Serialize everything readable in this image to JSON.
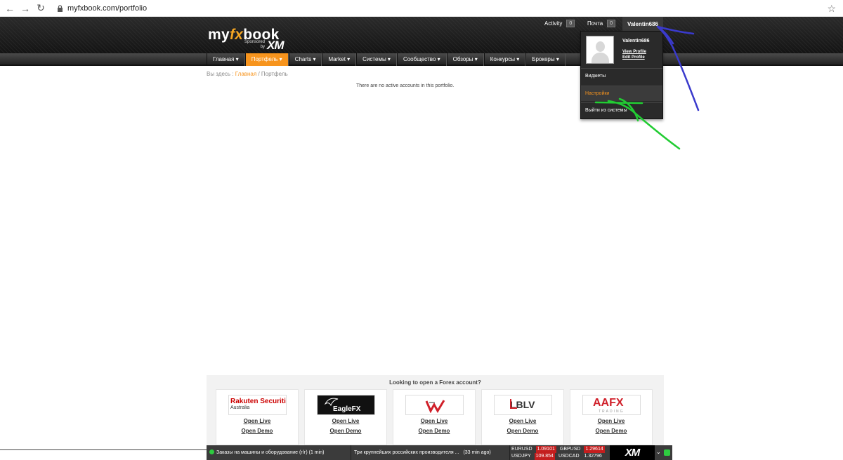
{
  "browser": {
    "back_icon": "arrow-left-icon",
    "forward_icon": "arrow-right-icon",
    "reload_icon": "reload-icon",
    "url": "myfxbook.com/portfolio",
    "star_icon": "star-icon"
  },
  "header": {
    "logo_part1": "my",
    "logo_fx": "fx",
    "logo_part2": "book",
    "sponsored_line1": "Sponsored",
    "sponsored_line2": "by",
    "sponsor_brand": "XM",
    "activity_label": "Activity",
    "activity_count": "0",
    "mail_label": "Почта",
    "mail_count": "0",
    "username": "Valentin686"
  },
  "nav": {
    "items": [
      {
        "label": "Главная ▾"
      },
      {
        "label": "Портфель ▾"
      },
      {
        "label": "Charts ▾"
      },
      {
        "label": "Market ▾"
      },
      {
        "label": "Системы ▾"
      },
      {
        "label": "Сообщество ▾"
      },
      {
        "label": "Обзоры ▾"
      },
      {
        "label": "Конкурсы ▾"
      },
      {
        "label": "Брокеры ▾"
      }
    ],
    "active_index": 1
  },
  "breadcrumb": {
    "prefix": "Вы здесь :",
    "home": "Главная",
    "separator": "/",
    "current": "Портфель"
  },
  "main": {
    "empty_message": "There are no active accounts in this portfolio."
  },
  "dropdown": {
    "name": "Valentin686",
    "view_profile": "View Profile",
    "edit_profile": "Edit Profile",
    "widgets": "Виджеты",
    "settings": "Настройки",
    "logout": "Выйти из системы"
  },
  "brokers": {
    "title": "Looking to open a Forex account?",
    "open_live": "Open Live",
    "open_demo": "Open Demo",
    "items": [
      {
        "name": "Rakuten Securities",
        "sub": "Australia"
      },
      {
        "name": "EagleFX",
        "sub": ""
      },
      {
        "name": "",
        "sub": ""
      },
      {
        "name": "LBLV",
        "sub": ""
      },
      {
        "name": "AAFX",
        "sub": "TRADING"
      }
    ]
  },
  "ticker": {
    "news1": "Заказы на машины и оборудование (г/г) (1 min)",
    "news2": "Три крупнейших российских производителя ...",
    "news2_time": "(33 min ago)",
    "rates": [
      {
        "pair": "EURUSD",
        "price": "1.09101",
        "pair2": "GBPUSD",
        "price2": "1.29614"
      },
      {
        "pair": "USDJPY",
        "price": "109.854",
        "pair2": "USDCAD",
        "price2": "1.32796"
      }
    ],
    "brand": "XM"
  },
  "annotation_colors": {
    "blue": "#3a3acc",
    "green": "#22cc33"
  }
}
